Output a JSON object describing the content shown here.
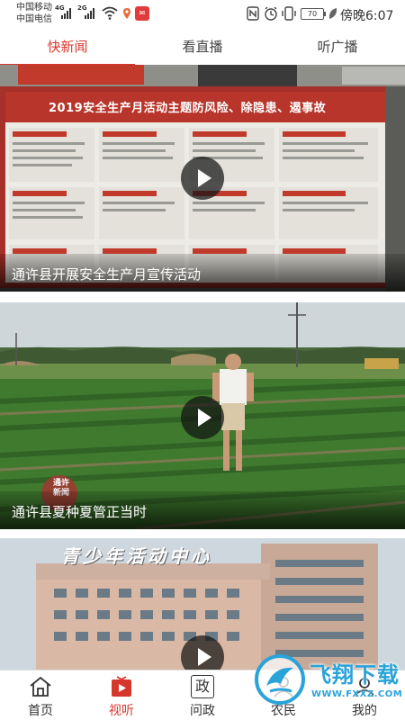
{
  "status_bar": {
    "carrier_1": "中国移动",
    "carrier_2": "中国电信",
    "net_1": "4G",
    "net_2": "2G",
    "battery": "70",
    "time": "傍晚6:07"
  },
  "tabs": [
    {
      "label": "快新闻",
      "active": true
    },
    {
      "label": "看直播",
      "active": false
    },
    {
      "label": "听广播",
      "active": false
    }
  ],
  "videos": [
    {
      "title": "通许县开展安全生产月宣传活动",
      "banner": "2019安全生产月活动主题防风险、除隐患、遏事故"
    },
    {
      "title": "通许县夏种夏管正当时",
      "logo": "通许新闻"
    },
    {
      "title": "",
      "building_sign": "青少年活动中心"
    }
  ],
  "bottom_nav": [
    {
      "label": "首页",
      "icon": "home-icon",
      "active": false
    },
    {
      "label": "视听",
      "icon": "video-icon",
      "active": true
    },
    {
      "label": "问政",
      "icon": "zheng-icon",
      "glyph": "政",
      "active": false
    },
    {
      "label": "农民",
      "icon": "farmer-icon",
      "active": false
    },
    {
      "label": "我的",
      "icon": "profile-icon",
      "active": false
    }
  ],
  "watermark": {
    "text": "飞翔下载",
    "url": "WWW.FXXZ.COM"
  },
  "colors": {
    "accent": "#d6372c"
  }
}
